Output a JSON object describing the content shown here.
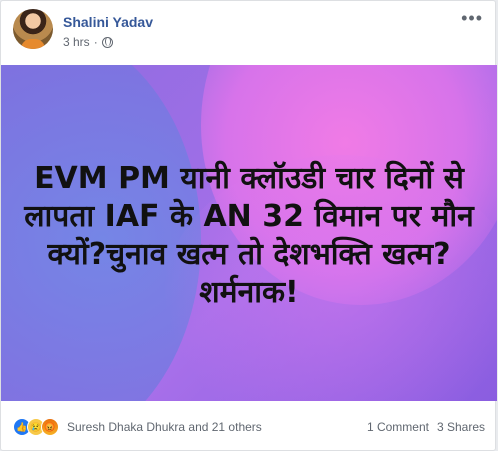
{
  "post": {
    "author": "Shalini Yadav",
    "time": "3 hrs",
    "separator": "·",
    "more": "•••",
    "text": "EVM PM यानी क्लॉउडी चार दिनों से लापता IAF के AN 32 विमान पर मौन क्यों?चुनाव खत्म तो देशभक्ति खत्म?शर्मनाक!"
  },
  "reactions": {
    "icons": [
      "like-icon",
      "sad-icon",
      "angry-icon"
    ],
    "glyphs": {
      "like": "👍",
      "sad": "😢",
      "angry": "😡"
    },
    "names": "Suresh Dhaka Dhukra and 21 others",
    "comments": "1 Comment",
    "shares": "3 Shares"
  },
  "colors": {
    "link": "#365899",
    "meta": "#616770",
    "like": "#2078f4"
  }
}
